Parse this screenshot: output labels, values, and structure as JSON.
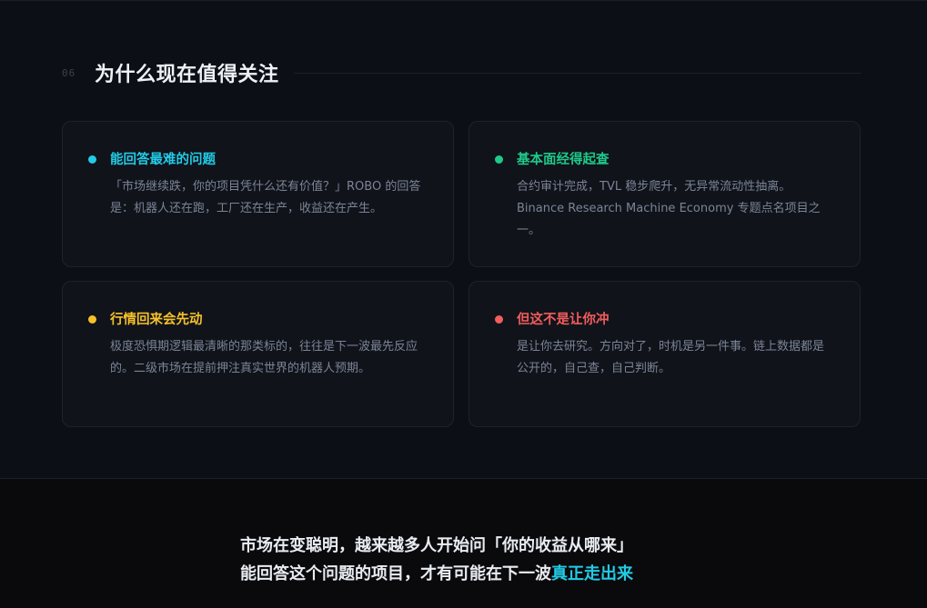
{
  "section": {
    "number": "06",
    "title": "为什么现在值得关注"
  },
  "cards": [
    {
      "title": "能回答最难的问题",
      "body": "「市场继续跌，你的项目凭什么还有价值？」ROBO 的回答是：机器人还在跑，工厂还在生产，收益还在产生。",
      "color": "#22cbe6"
    },
    {
      "title": "基本面经得起查",
      "body": "合约审计完成，TVL 稳步爬升，无异常流动性抽离。Binance Research Machine Economy 专题点名项目之一。",
      "color": "#1fc98a"
    },
    {
      "title": "行情回来会先动",
      "body": "极度恐惧期逻辑最清晰的那类标的，往往是下一波最先反应的。二级市场在提前押注真实世界的机器人预期。",
      "color": "#f6c02a"
    },
    {
      "title": "但这不是让你冲",
      "body": "是让你去研究。方向对了，时机是另一件事。链上数据都是公开的，自己查，自己判断。",
      "color": "#f25d5d"
    }
  ],
  "closing": {
    "line1": "市场在变聪明，越来越多人开始问「你的收益从哪来」",
    "line2_prefix": "能回答这个问题的项目，才有可能在下一波",
    "line2_highlight": "真正走出来",
    "highlight_color": "#22cbe6"
  }
}
